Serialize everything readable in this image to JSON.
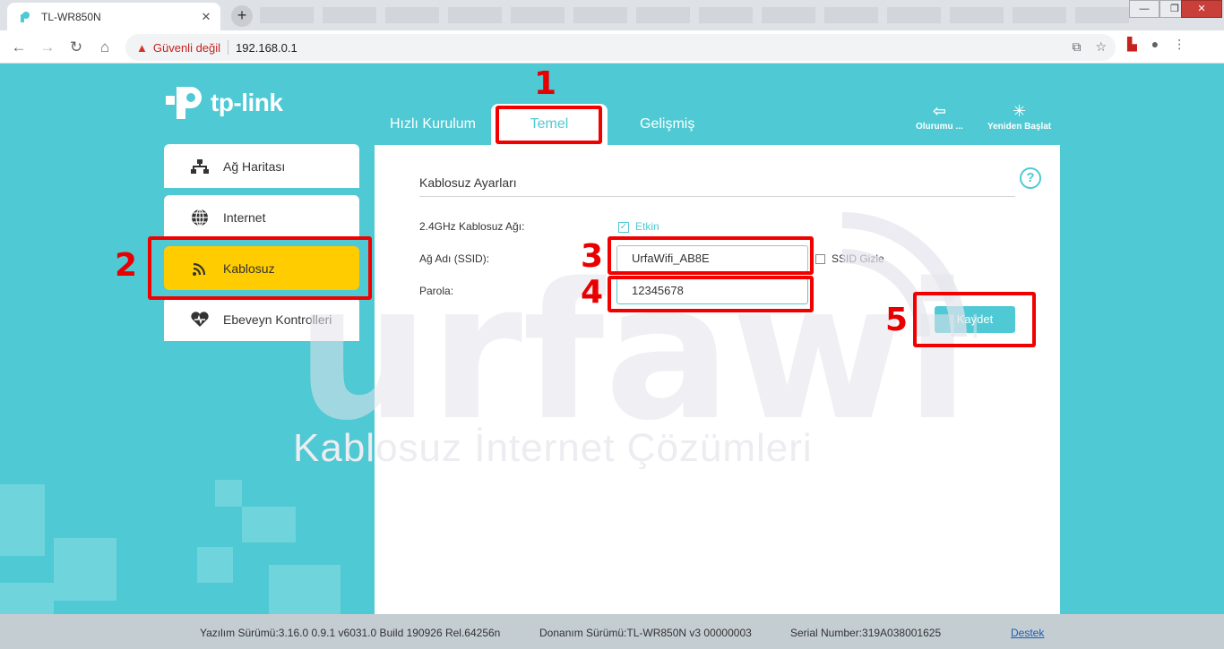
{
  "browser": {
    "tab_title": "TL-WR850N",
    "tab_close": "✕",
    "new_tab": "+",
    "security_label": "Güvenli değil",
    "url": "192.168.0.1"
  },
  "logo": {
    "text": "tp-link"
  },
  "topnav": {
    "tabs": [
      {
        "label": "Hızlı Kurulum"
      },
      {
        "label": "Temel"
      },
      {
        "label": "Gelişmiş"
      }
    ],
    "actions": [
      {
        "label": "Olurumu ...",
        "icon": "logout-icon"
      },
      {
        "label": "Yeniden Başlat",
        "icon": "reboot-icon"
      }
    ]
  },
  "sidebar": {
    "items": [
      {
        "label": "Ağ Haritası",
        "icon": "network-map-icon"
      },
      {
        "label": "Internet",
        "icon": "globe-icon"
      },
      {
        "label": "Kablosuz",
        "icon": "wireless-icon"
      },
      {
        "label": "Ebeveyn Kontrolleri",
        "icon": "heart-icon"
      }
    ]
  },
  "wireless": {
    "title": "Kablosuz Ayarları",
    "band_label": "2.4GHz Kablosuz Ağı:",
    "enabled_label": "Etkin",
    "ssid_label": "Ağ Adı (SSID):",
    "ssid_value": "UrfaWifi_AB8E",
    "hide_ssid_label": "SSID Gizle",
    "password_label": "Parola:",
    "password_value": "12345678",
    "save_label": "Kaydet"
  },
  "watermark": {
    "brand": "urfawifi",
    "tagline": "Kablosuz İnternet Çözümleri"
  },
  "annotations": [
    "1",
    "2",
    "3",
    "4",
    "5"
  ],
  "footer": {
    "firmware": "Yazılım Sürümü:3.16.0 0.9.1 v6031.0 Build 190926 Rel.64256n",
    "hardware": "Donanım Sürümü:TL-WR850N v3 00000003",
    "serial": "Serial Number:319A038001625",
    "support": "Destek"
  },
  "colors": {
    "accent": "#4fc9d3",
    "active_menu": "#ffcc00",
    "annotation": "#f20000"
  }
}
